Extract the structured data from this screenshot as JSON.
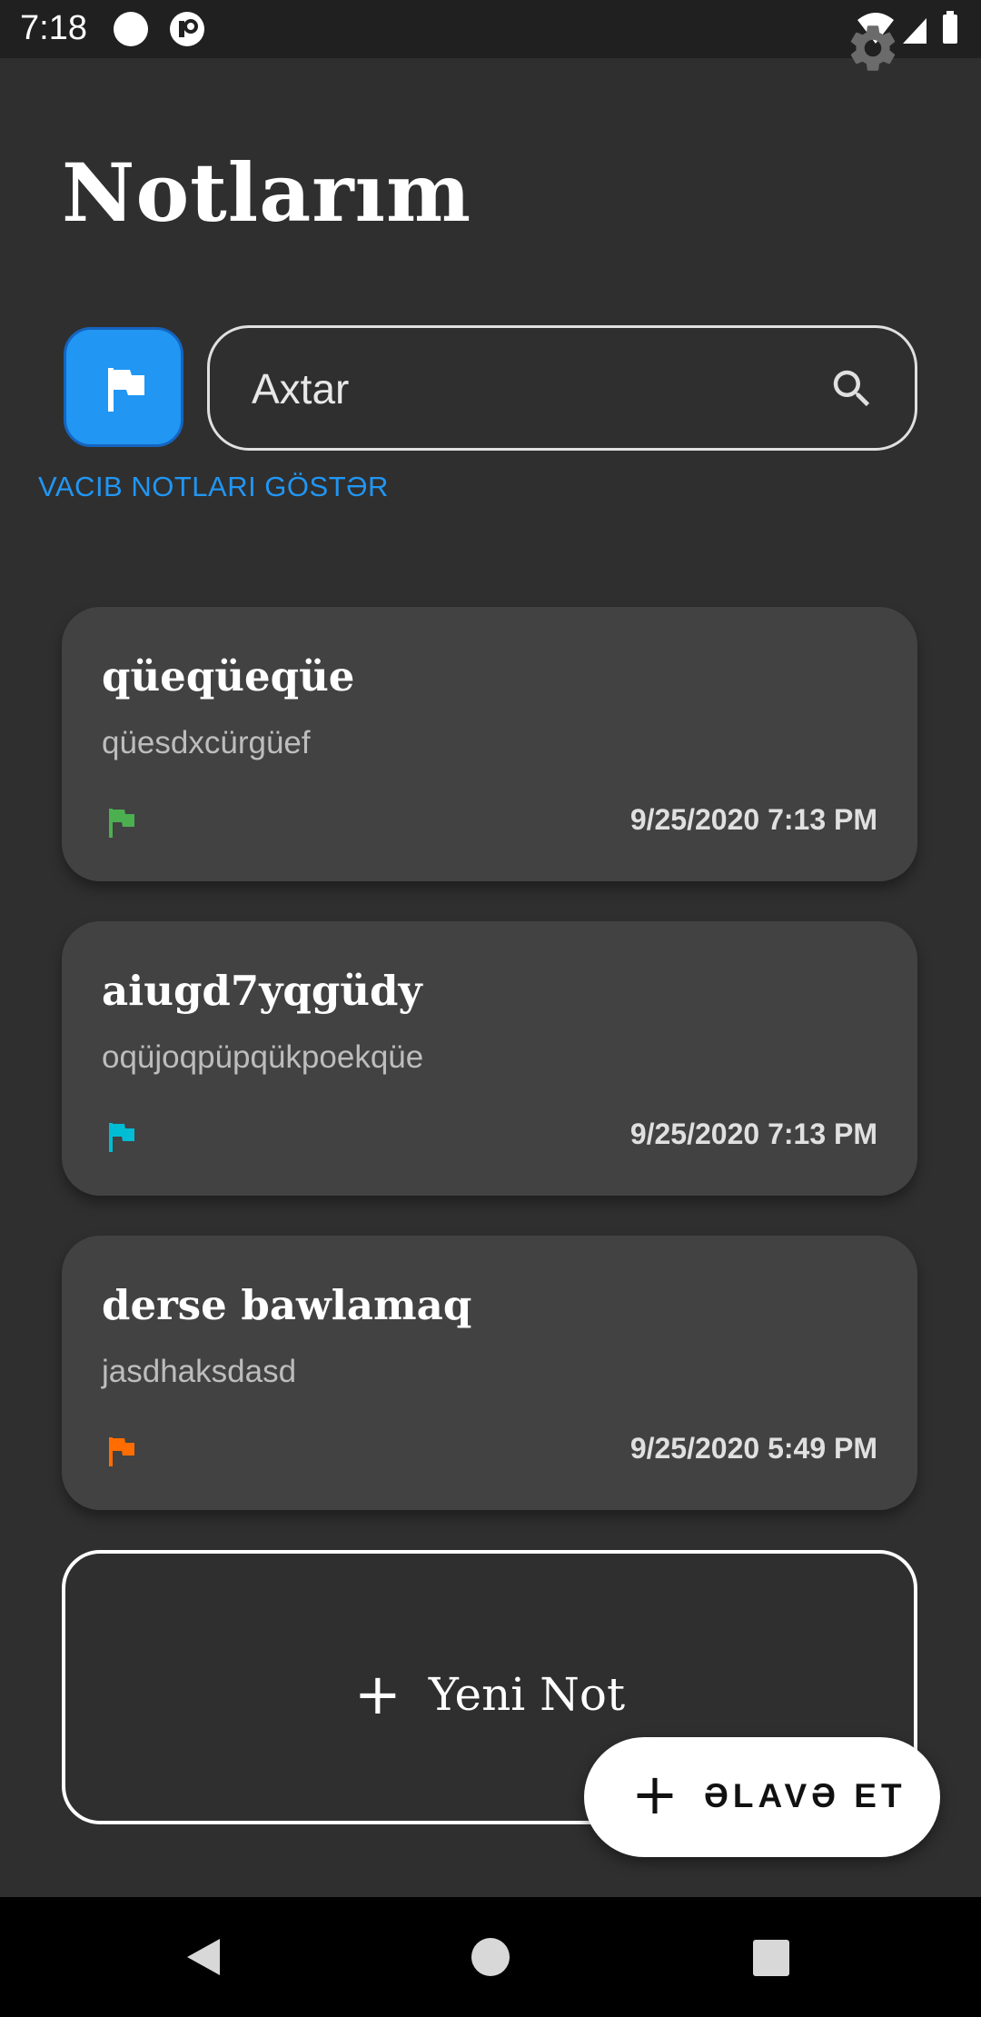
{
  "status_bar": {
    "time": "7:18"
  },
  "header": {
    "title": "Notlarım"
  },
  "filter": {
    "label": "VACIB NOTLARI GÖSTƏR"
  },
  "search": {
    "placeholder": "Axtar"
  },
  "notes": [
    {
      "title": "qüeqüeqüe",
      "body": "qüesdxcürgüef",
      "date": "9/25/2020 7:13 PM",
      "flag_color": "#4caf50"
    },
    {
      "title": "aiugd7yqgüdy",
      "body": "oqüjoqpüpqükpoekqüe",
      "date": "9/25/2020 7:13 PM",
      "flag_color": "#00bcd4"
    },
    {
      "title": "derse bawlamaq",
      "body": "jasdhaksdasd",
      "date": "9/25/2020 5:49 PM",
      "flag_color": "#ff6d00"
    }
  ],
  "new_note": {
    "label": "Yeni Not"
  },
  "fab": {
    "label": "ƏLAVƏ ET"
  },
  "colors": {
    "accent": "#2196f3",
    "background": "#2f2f2f",
    "card": "#424242"
  },
  "icons": {
    "settings": "gear-icon",
    "flag_button": "flag-icon",
    "search": "search-icon",
    "note_flag": "flag-icon",
    "add": "plus-icon",
    "nav": [
      "back-icon",
      "home-icon",
      "recents-icon"
    ]
  }
}
